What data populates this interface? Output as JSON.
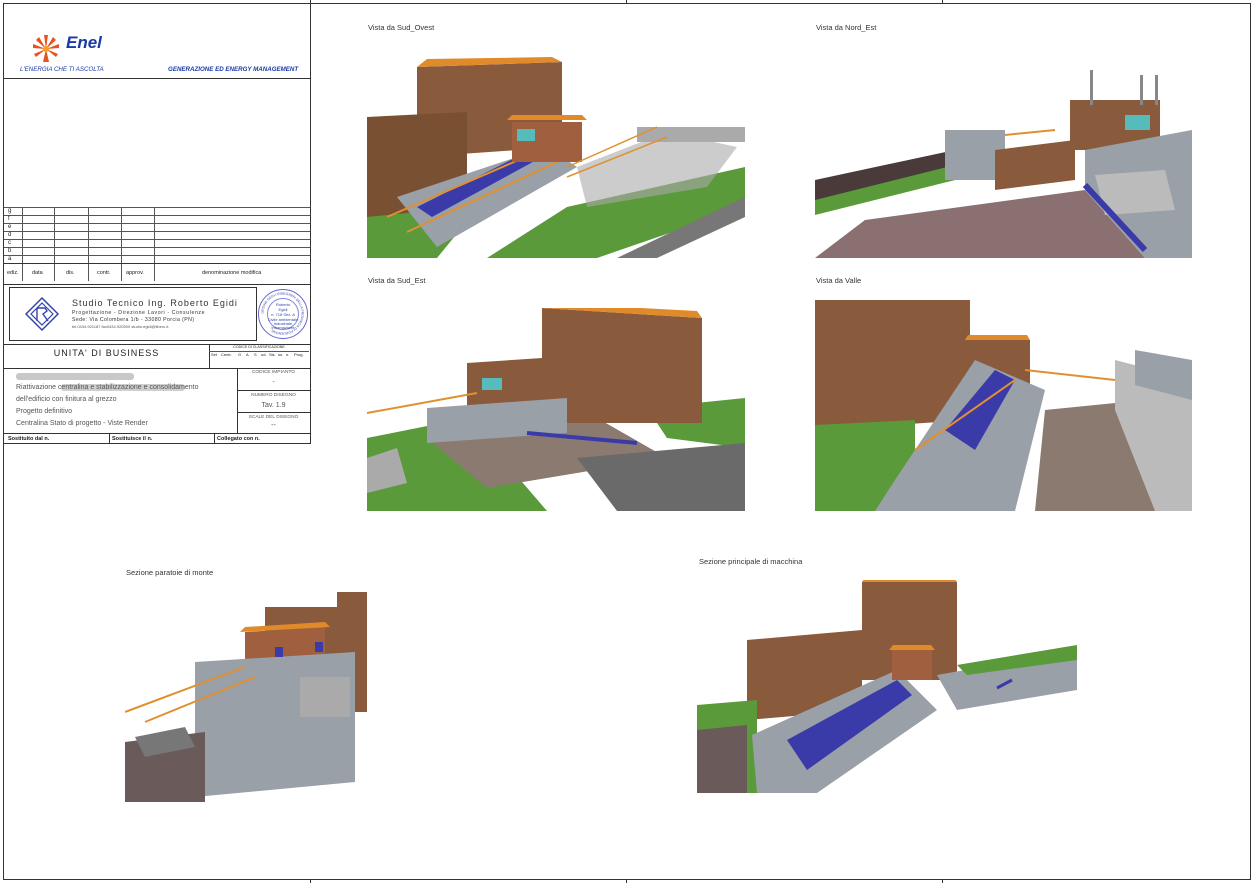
{
  "title_block": {
    "company": "Enel",
    "tagline": "L'ENERGIA CHE TI ASCOLTA",
    "department": "GENERAZIONE ED ENERGY MANAGEMENT",
    "revision_rows": [
      "g",
      "f",
      "e",
      "d",
      "c",
      "b",
      "a"
    ],
    "revision_headers": [
      "ediz.",
      "data",
      "dis.",
      "contr.",
      "approv.",
      "denominazione modifica"
    ],
    "studio": {
      "name": "Studio Tecnico Ing. Roberto Egidi",
      "line2": "Progettazione - Direzione Lavori - Consulenze",
      "line3": "Sede: Via Colombera 1/b - 33080 Porcia (PN)",
      "line4": "tel.0434.921187 fax0434.920500  studio.egidi@libero.it"
    },
    "stamp": {
      "ring": "ORDINE DEGLI INGEGNERI DELLA PROVINCIA DI PORDENONE",
      "name_line1": "Roberto",
      "name_line2": "Egidi",
      "number": "n. 718 Sez. A",
      "sector_line1": "Civile ambientale",
      "sector_line2": "industriale",
      "sector_line3": "informazione"
    },
    "unit_label": "UNITA' DI BUSINESS",
    "classification_label": "CODICE DI CLASSIFICAZIONE",
    "classification_columns": [
      "Set",
      "Centr.",
      "G",
      "A",
      "S",
      "ud.",
      "Sis.",
      "so.",
      "n.",
      "Prog."
    ],
    "description": [
      "Riattivazione centralina e stabilizzazione e consolidamento",
      "dell'edificio con finitura al grezzo",
      "Progetto definitivo",
      "Centralina Stato di progetto - Viste Render"
    ],
    "codice_impianto_label": "CODICE IMPIANTO",
    "codice_impianto_value": "-",
    "numero_disegno_label": "NUMERO DISEGNO",
    "numero_disegno_value": "Tav. 1.9",
    "scala_label": "SCALE DEL DISEGNO",
    "scala_value": "--",
    "footer": [
      "Sostituito dal n.",
      "Sostituisce il n.",
      "Collegato con n."
    ]
  },
  "views": {
    "sud_ovest": "Vista da Sud_Ovest",
    "nord_est": "Vista da Nord_Est",
    "sud_est": "Vista da Sud_Est",
    "valle": "Vista da Valle",
    "paratoie": "Sezione paratoie di monte",
    "macchina": "Sezione principale di macchina"
  },
  "colors": {
    "brick": "#8a5a3c",
    "roof": "#e08a2a",
    "concrete": "#9aa0a8",
    "grass": "#5a9a3a",
    "pipe": "#3a3aa8",
    "railing": "#e09030",
    "road": "#6a6a6a"
  }
}
